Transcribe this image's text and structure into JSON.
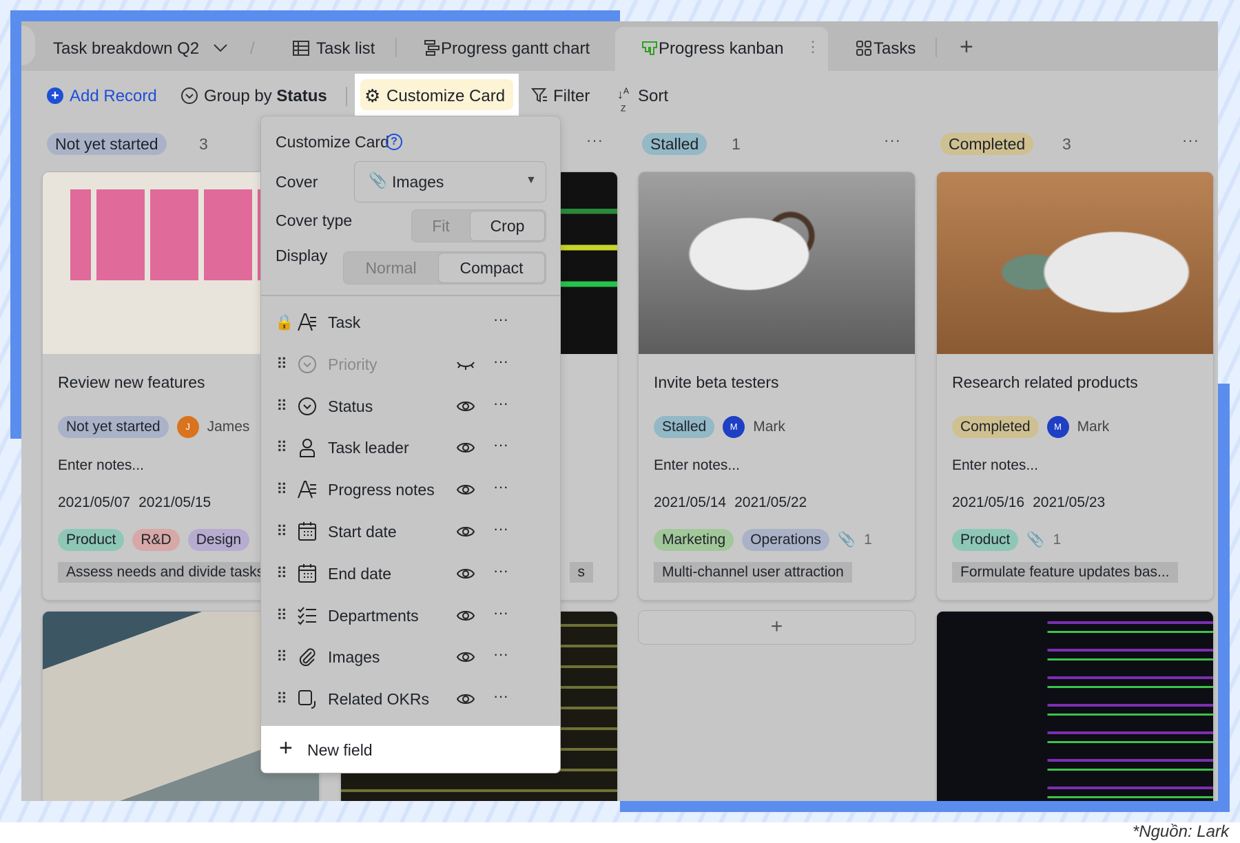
{
  "caption": "*Nguồn: Lark",
  "colors": {
    "accent": "#1f4ed8",
    "frame_blue": "#5b8def",
    "highlight": "#fdf3d5",
    "kanban_icon": "#2ea121"
  },
  "tabs": {
    "base_title": "Task breakdown Q2",
    "items": [
      {
        "label": "Task list",
        "icon": "table-icon"
      },
      {
        "label": "Progress gantt chart",
        "icon": "gantt-icon"
      },
      {
        "label": "Progress kanban",
        "icon": "kanban-icon",
        "active": true
      },
      {
        "label": "Tasks",
        "icon": "grid-icon"
      }
    ]
  },
  "toolbar": {
    "add_record": "Add Record",
    "group_by": "Group by",
    "group_field": "Status",
    "customize_card": "Customize Card",
    "filter": "Filter",
    "sort": "Sort"
  },
  "columns": [
    {
      "status": "Not yet started",
      "count": "3",
      "color": "#aab2c8"
    },
    {
      "status": "",
      "count": ""
    },
    {
      "status": "Stalled",
      "count": "1",
      "color": "#93b8c6"
    },
    {
      "status": "Completed",
      "count": "3",
      "color": "#cfc091"
    }
  ],
  "cards": [
    {
      "title": "Review new features",
      "status": "Not yet started",
      "leader": "James",
      "leader_initial": "J",
      "notes": "Enter notes...",
      "start": "2021/05/07",
      "end": "2021/05/15",
      "departments": [
        "Product",
        "R&D",
        "Design"
      ],
      "okr": "Assess needs and divide tasks"
    },
    {
      "okr": "s"
    },
    {
      "title": "Invite beta testers",
      "status": "Stalled",
      "leader": "Mark",
      "leader_initial": "M",
      "notes": "Enter notes...",
      "start": "2021/05/14",
      "end": "2021/05/22",
      "departments": [
        "Marketing",
        "Operations"
      ],
      "attachments": "1",
      "okr": "Multi-channel user attraction"
    },
    {
      "title": "Research related products",
      "status": "Completed",
      "leader": "Mark",
      "leader_initial": "M",
      "notes": "Enter notes...",
      "start": "2021/05/16",
      "end": "2021/05/23",
      "departments": [
        "Product"
      ],
      "attachments": "1",
      "okr": "Formulate feature updates bas..."
    }
  ],
  "popup": {
    "title": "Customize Card",
    "cover_label": "Cover",
    "cover_value": "Images",
    "cover_type_label": "Cover type",
    "cover_type_options": [
      "Fit",
      "Crop"
    ],
    "cover_type_selected": "Crop",
    "display_label": "Display",
    "display_options": [
      "Normal",
      "Compact"
    ],
    "display_selected": "Compact",
    "fields": [
      {
        "label": "Task",
        "icon": "text-icon",
        "locked": true
      },
      {
        "label": "Priority",
        "icon": "single-select-icon",
        "visible": false
      },
      {
        "label": "Status",
        "icon": "single-select-icon",
        "visible": true
      },
      {
        "label": "Task leader",
        "icon": "person-icon",
        "visible": true
      },
      {
        "label": "Progress notes",
        "icon": "text-icon",
        "visible": true
      },
      {
        "label": "Start date",
        "icon": "calendar-icon",
        "visible": true
      },
      {
        "label": "End date",
        "icon": "calendar-icon",
        "visible": true
      },
      {
        "label": "Departments",
        "icon": "multi-select-icon",
        "visible": true
      },
      {
        "label": "Images",
        "icon": "attachment-icon",
        "visible": true
      },
      {
        "label": "Related OKRs",
        "icon": "link-record-icon",
        "visible": true
      }
    ],
    "new_field": "New field"
  }
}
